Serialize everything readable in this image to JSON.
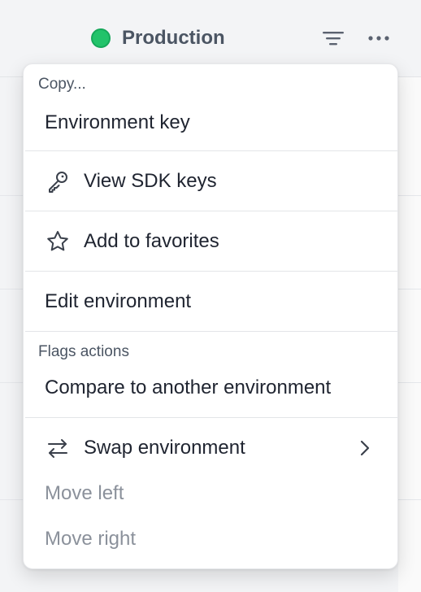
{
  "header": {
    "environment_name": "Production",
    "environment_color": "#22c36a",
    "filter_icon": "filter-icon",
    "more_icon": "more-horizontal-icon"
  },
  "menu": {
    "copy_section_label": "Copy...",
    "environment_key": "Environment key",
    "view_sdk_keys": "View SDK keys",
    "add_to_favorites": "Add to favorites",
    "edit_environment": "Edit environment",
    "flags_section_label": "Flags actions",
    "compare_environment": "Compare to another environment",
    "swap_environment": "Swap environment",
    "move_left": "Move left",
    "move_right": "Move right",
    "icons": {
      "sdk": "key-icon",
      "favorites": "star-icon",
      "swap": "swap-arrows-icon",
      "submenu": "chevron-right-icon"
    }
  }
}
